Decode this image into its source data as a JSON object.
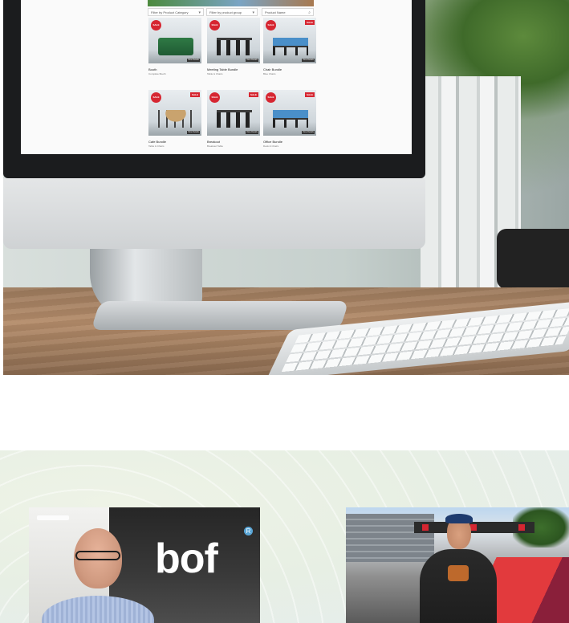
{
  "screen": {
    "filters": [
      {
        "label": "Filter by Product Category"
      },
      {
        "label": "Filter by product group"
      },
      {
        "label": "Product Name"
      }
    ],
    "products": [
      {
        "name": "Booth",
        "sub": "Complete Booth",
        "sale": "SALE",
        "badge": "",
        "tag": "View Details",
        "style": "green"
      },
      {
        "name": "Meeting Table Bundle",
        "sub": "Table & Chairs",
        "sale": "SALE",
        "badge": "",
        "tag": "View Details",
        "style": "table"
      },
      {
        "name": "Chair Bundle",
        "sub": "Blue Chairs",
        "sale": "SALE",
        "badge": "SALE",
        "tag": "View Details",
        "style": "blue"
      },
      {
        "name": "Cafe Bundle",
        "sub": "Table & Chairs",
        "sale": "SALE",
        "badge": "SALE",
        "tag": "View Details",
        "style": "round"
      },
      {
        "name": "Breakout",
        "sub": "Breakout Table",
        "sale": "SALE",
        "badge": "SALE",
        "tag": "View Details",
        "style": "table"
      },
      {
        "name": "Office Bundle",
        "sub": "Desk & Chairs",
        "sale": "SALE",
        "badge": "SALE",
        "tag": "View Details",
        "style": "blue"
      }
    ]
  },
  "team": {
    "logo_text": "bof",
    "logo_mark": "R"
  },
  "colors": {
    "accent_red": "#d62631",
    "logo_blue": "#5aa6d6"
  }
}
